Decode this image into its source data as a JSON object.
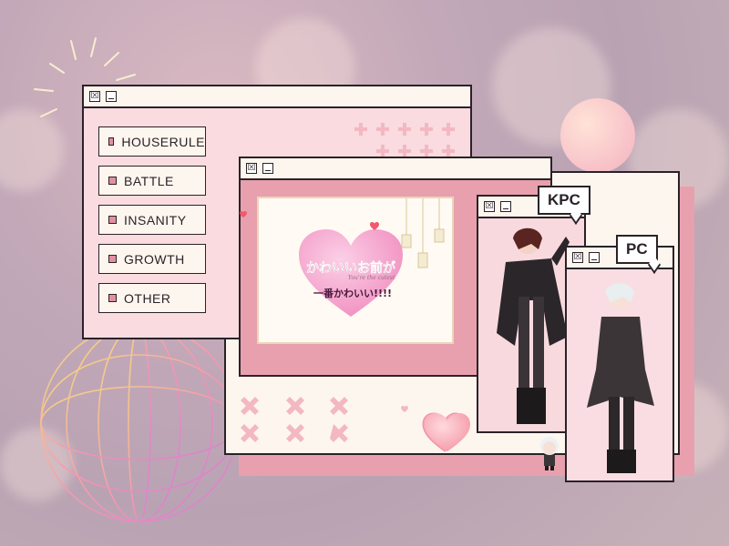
{
  "menu": {
    "items": [
      {
        "label": "HOUSERULE"
      },
      {
        "label": "BATTLE"
      },
      {
        "label": "INSANITY"
      },
      {
        "label": "GROWTH"
      },
      {
        "label": "OTHER"
      }
    ]
  },
  "title_card": {
    "line1": "かわいいお前が",
    "line2": "一番かわいい!!!!",
    "sub": "You're the cutest"
  },
  "characters": {
    "kpc_label": "KPC",
    "pc_label": "PC"
  },
  "window_controls": {
    "close": "☒",
    "minimize": "_"
  },
  "colors": {
    "accent": "#e8a0ae",
    "window": "#fdf6ee",
    "border": "#2a2228",
    "heart": "#f06e9a"
  }
}
